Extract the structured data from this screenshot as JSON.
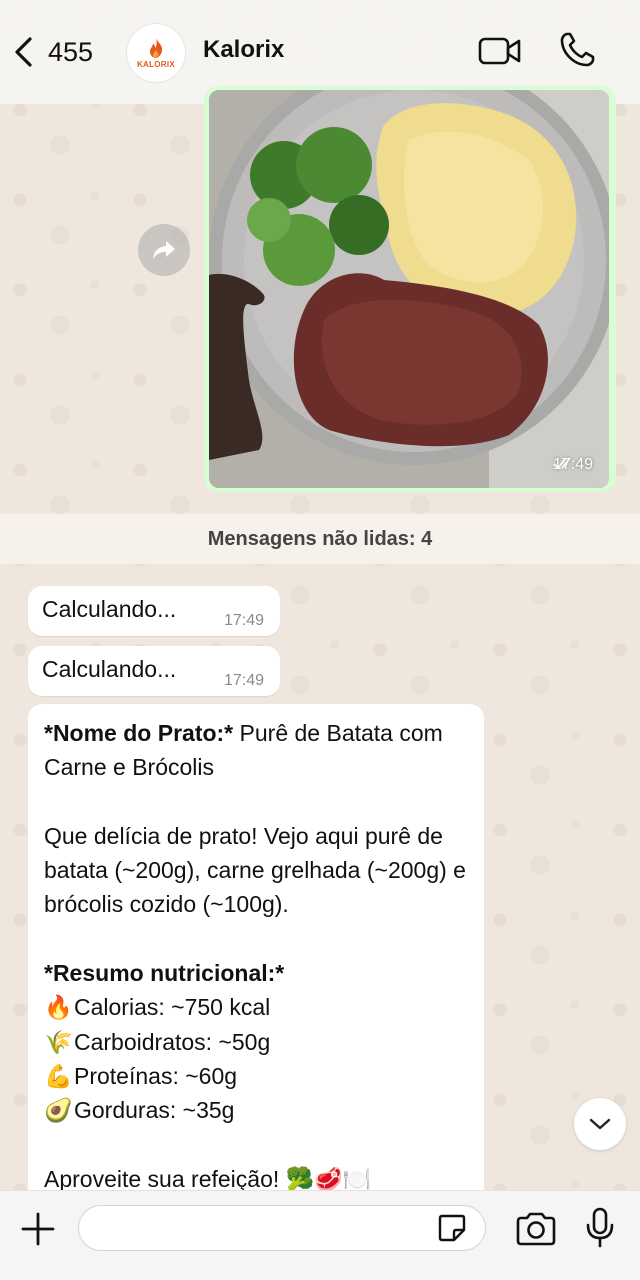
{
  "header": {
    "back_count": "455",
    "contact_name": "Kalorix",
    "avatar_text": "KALORIX"
  },
  "image_message": {
    "time": "17:49"
  },
  "unread_divider": "Mensagens não lidas: 4",
  "messages": [
    {
      "text": "Calculando...",
      "time": "17:49"
    },
    {
      "text": "Calculando...",
      "time": "17:49"
    }
  ],
  "result": {
    "dish_label": "*Nome do Prato:*",
    "dish_name": " Purê de Batata com Carne e Brócolis",
    "description": "Que delícia de prato! Vejo aqui purê de batata (~200g), carne grelhada (~200g) e brócolis cozido (~100g).",
    "summary_title": "*Resumo nutricional:*",
    "nutrients": [
      {
        "emoji": "🔥",
        "text": "Calorias: ~750 kcal"
      },
      {
        "emoji": "🌾",
        "text": "Carboidratos: ~50g"
      },
      {
        "emoji": "💪",
        "text": "Proteínas: ~60g"
      },
      {
        "emoji": "🥑",
        "text": "Gorduras: ~35g"
      }
    ],
    "closing": "Aproveite sua refeição! 🥦🥩🍽️"
  },
  "composer": {
    "input_value": "",
    "input_placeholder": ""
  },
  "colors": {
    "outgoing_bubble": "#d9fdd3",
    "incoming_bubble": "#ffffff",
    "chat_background": "#efe7de",
    "brand": "#e8571e"
  }
}
